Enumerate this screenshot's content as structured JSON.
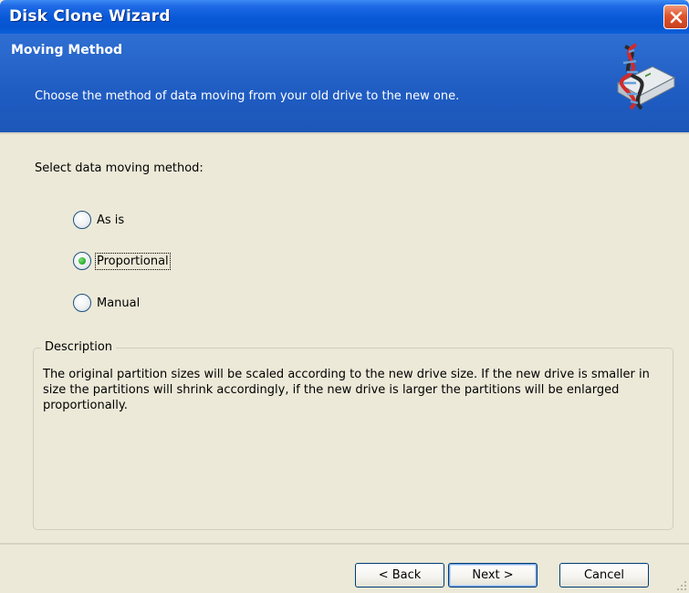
{
  "window": {
    "title": "Disk Clone Wizard"
  },
  "header": {
    "title": "Moving Method",
    "subtitle": "Choose the method of data moving from your old drive to the new one.",
    "icon": "disk-clone-wizard-icon"
  },
  "main": {
    "prompt": "Select data moving method:",
    "options": [
      {
        "label": "As is",
        "checked": false
      },
      {
        "label": "Proportional",
        "checked": true
      },
      {
        "label": "Manual",
        "checked": false
      }
    ],
    "description": {
      "title": "Description",
      "text": "The original partition sizes will be scaled according to the new drive size. If the new drive is smaller in size the partitions will shrink accordingly, if the new drive is larger the partitions will be enlarged proportionally."
    }
  },
  "buttons": {
    "back": "< Back",
    "next": "Next >",
    "cancel": "Cancel"
  },
  "colors": {
    "title_bar": "#0a5ad8",
    "header_band": "#1f5cc2",
    "dialog_face": "#ece9d8",
    "radio_selected": "#2fb32f",
    "close_button": "#e0542e"
  }
}
